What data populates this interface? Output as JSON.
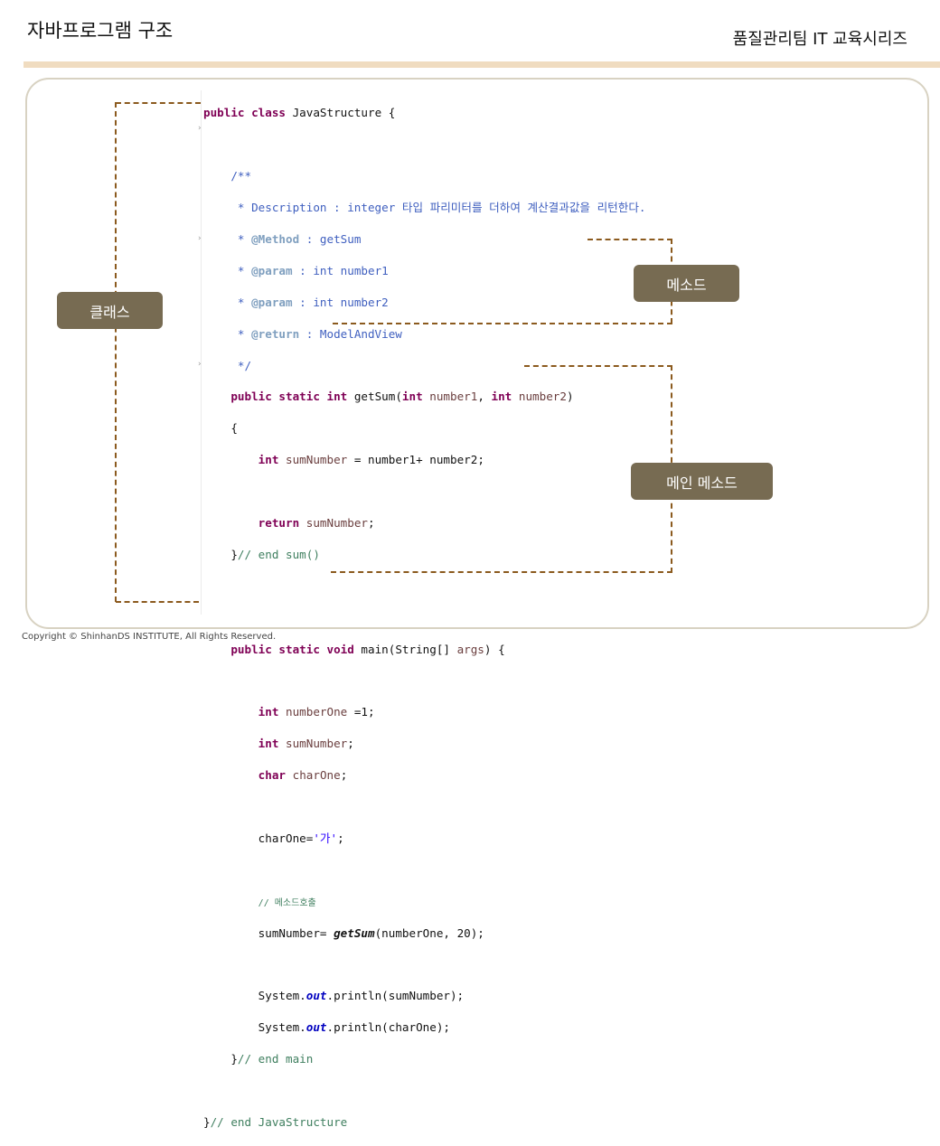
{
  "header": {
    "title": "자바프로그램 구조",
    "series": "품질관리팀 IT 교육시리즈"
  },
  "labels": {
    "class": "클래스",
    "method": "메소드",
    "main_method": "메인 메소드"
  },
  "code": {
    "l1_kw": "public class",
    "l1_rest": " JavaStructure {",
    "doc_open": "    /**",
    "doc_desc": "     * Description : integer 타입 파리미터를 더하여 계산결과값을 리턴한다.",
    "doc_method_tag": "@Method",
    "doc_method_rest": " : getSum",
    "doc_param_tag": "@param",
    "doc_param1_rest": " : int number1",
    "doc_param2_rest": " : int number2",
    "doc_return_tag": "@return",
    "doc_return_rest": " : ModelAndView",
    "doc_close": "     */",
    "sig_kw": "public static int",
    "sig_name": " getSum(",
    "int_kw": "int",
    "var_number1": "number1",
    "var_number2": "number2",
    "open_brace": "    {",
    "var_sumNumber": "sumNumber",
    "expr_sum": " = number1+ number2;",
    "return_kw": "return",
    "end_sum": "// end sum()",
    "main_kw": "public static void",
    "main_name": " main(String[] ",
    "var_args": "args",
    "main_tail": ") {",
    "var_numberOne": "numberOne",
    "assign_one": " =1;",
    "char_kw": "char",
    "var_charOne": "charOne",
    "assign_char_prefix": "charOne=",
    "char_literal": "'가'",
    "comment_call": "// 메소드호출",
    "call_prefix": "sumNumber= ",
    "call_method": "getSum",
    "call_args": "(numberOne, 20);",
    "sysout_prefix": "System.",
    "sysout_field": "out",
    "println_sum": ".println(sumNumber);",
    "println_char": ".println(charOne);",
    "end_main": "// end main",
    "end_class": "// end JavaStructure"
  },
  "footer": {
    "copyright": "Copyright © ShinhanDS INSTITUTE, All Rights Reserved."
  },
  "colors": {
    "label_bg": "#776b52",
    "dash": "#8b5a1e",
    "accent_bar": "#f0dcc0"
  }
}
